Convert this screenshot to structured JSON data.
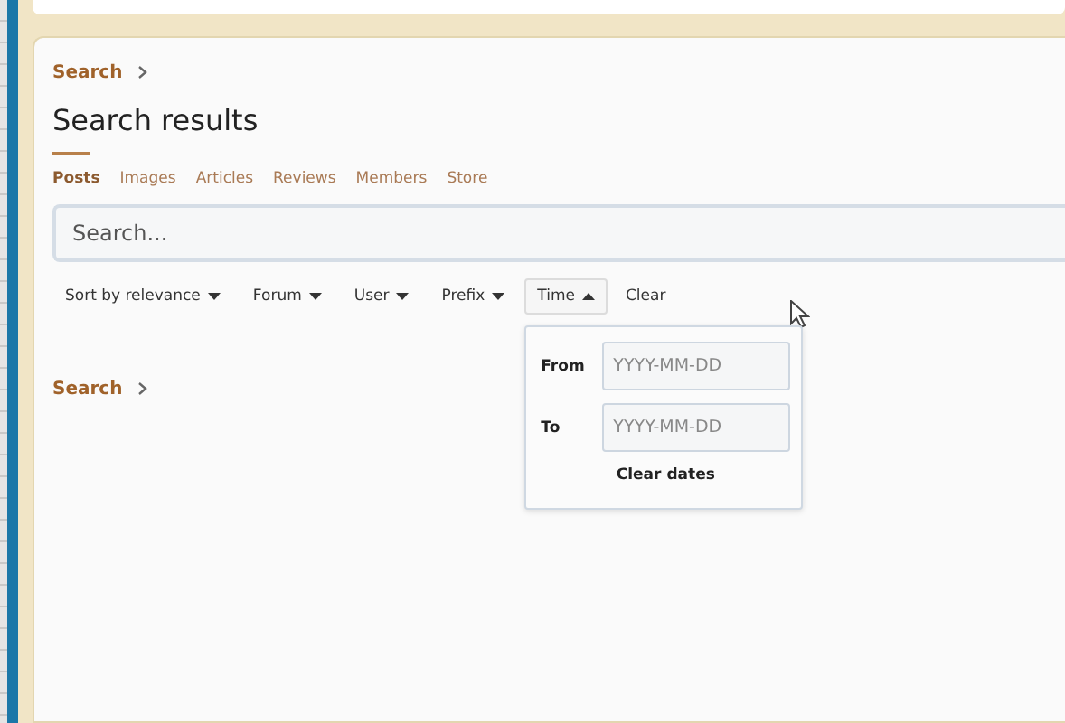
{
  "breadcrumb_top": {
    "label": "Search"
  },
  "title": "Search results",
  "tabs": [
    {
      "label": "Posts",
      "selected": true
    },
    {
      "label": "Images",
      "selected": false
    },
    {
      "label": "Articles",
      "selected": false
    },
    {
      "label": "Reviews",
      "selected": false
    },
    {
      "label": "Members",
      "selected": false
    },
    {
      "label": "Store",
      "selected": false
    }
  ],
  "search": {
    "placeholder": "Search..."
  },
  "filters": [
    {
      "label": "Sort by relevance",
      "expanded": false
    },
    {
      "label": "Forum",
      "expanded": false
    },
    {
      "label": "User",
      "expanded": false
    },
    {
      "label": "Prefix",
      "expanded": false
    },
    {
      "label": "Time",
      "expanded": true
    }
  ],
  "clear_link": "Clear",
  "time_menu": {
    "fields": [
      {
        "label": "From",
        "placeholder": "YYYY-MM-DD"
      },
      {
        "label": "To",
        "placeholder": "YYYY-MM-DD"
      }
    ],
    "clear_button": "Clear dates"
  },
  "breadcrumb_bottom": {
    "label": "Search"
  }
}
